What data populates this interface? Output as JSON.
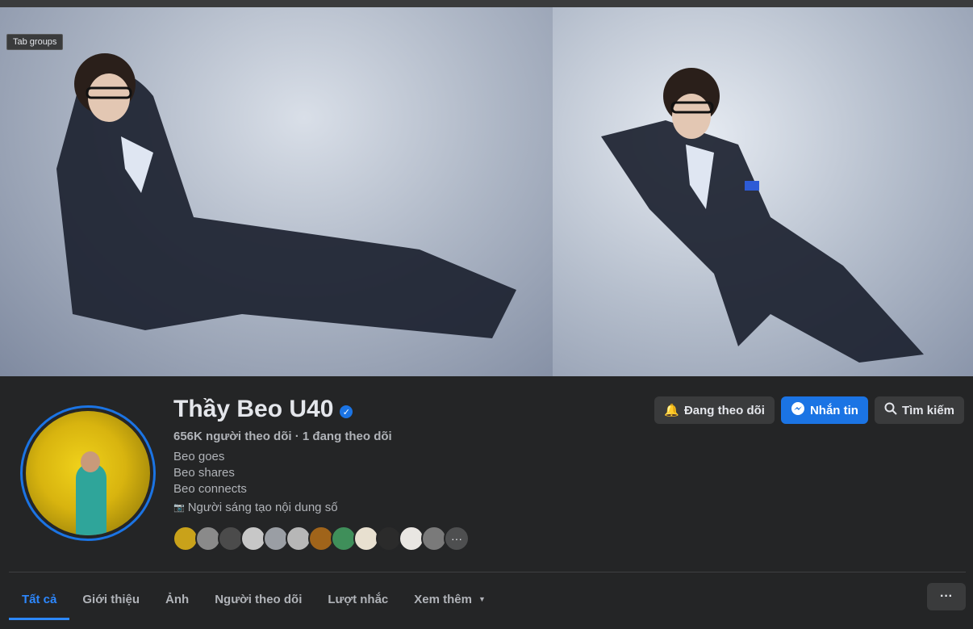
{
  "overlay": {
    "tab_groups": "Tab groups"
  },
  "profile": {
    "name": "Thầy Beo U40",
    "verified_icon": "verified-badge-icon",
    "followers": "656K người theo dõi",
    "separator": "·",
    "following": "1 đang theo dõi",
    "bio": [
      "Beo goes",
      "Beo shares",
      "Beo connects"
    ],
    "category_icon": "camera-icon",
    "category": "Người sáng tạo nội dung số"
  },
  "actions": {
    "following": {
      "label": "Đang theo dõi",
      "icon": "bell-icon"
    },
    "message": {
      "label": "Nhắn tin",
      "icon": "messenger-icon"
    },
    "search": {
      "label": "Tìm kiếm",
      "icon": "search-icon"
    }
  },
  "followers_avatars": [
    "#c9a21a",
    "#8a8a8a",
    "#4b4b4b",
    "#c7c7c7",
    "#9a9ea4",
    "#b7b7b7",
    "#a0641a",
    "#3f8f5a",
    "#e8e0d0",
    "#2b2b2b",
    "#e9e6e2",
    "#7a7a7a"
  ],
  "tabs": [
    {
      "label": "Tất cả",
      "active": true
    },
    {
      "label": "Giới thiệu"
    },
    {
      "label": "Ảnh"
    },
    {
      "label": "Người theo dõi"
    },
    {
      "label": "Lượt nhắc"
    },
    {
      "label": "Xem thêm",
      "dropdown": true
    }
  ],
  "more_menu": {
    "label": "···"
  },
  "colors": {
    "accent": "#1b74e4",
    "background": "#242526"
  }
}
